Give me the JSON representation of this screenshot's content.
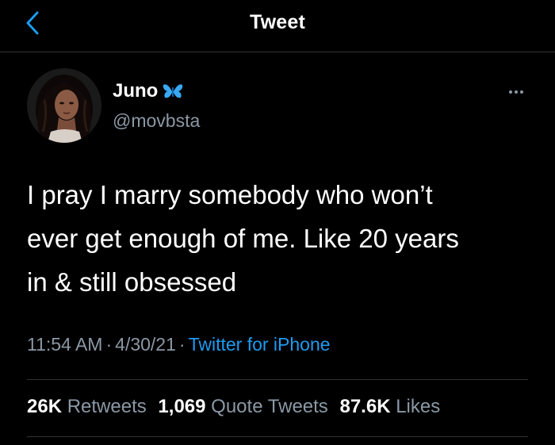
{
  "header": {
    "title": "Tweet",
    "back_icon": "chevron-left-icon"
  },
  "author": {
    "display_name": "Juno",
    "handle": "@movbsta",
    "badge_icon": "butterfly-icon"
  },
  "tweet": {
    "text": "I pray I marry somebody who won’t\never get enough of me. Like 20 years\nin & still obsessed",
    "time": "11:54 AM",
    "date": "4/30/21",
    "source": "Twitter for iPhone"
  },
  "stats": {
    "retweets_count": "26K",
    "retweets_label": "Retweets",
    "quotes_count": "1,069",
    "quotes_label": "Quote Tweets",
    "likes_count": "87.6K",
    "likes_label": "Likes"
  },
  "colors": {
    "background": "#000000",
    "accent": "#1d9bf0",
    "secondary_text": "#8b98a5",
    "divider": "#2f3336"
  }
}
